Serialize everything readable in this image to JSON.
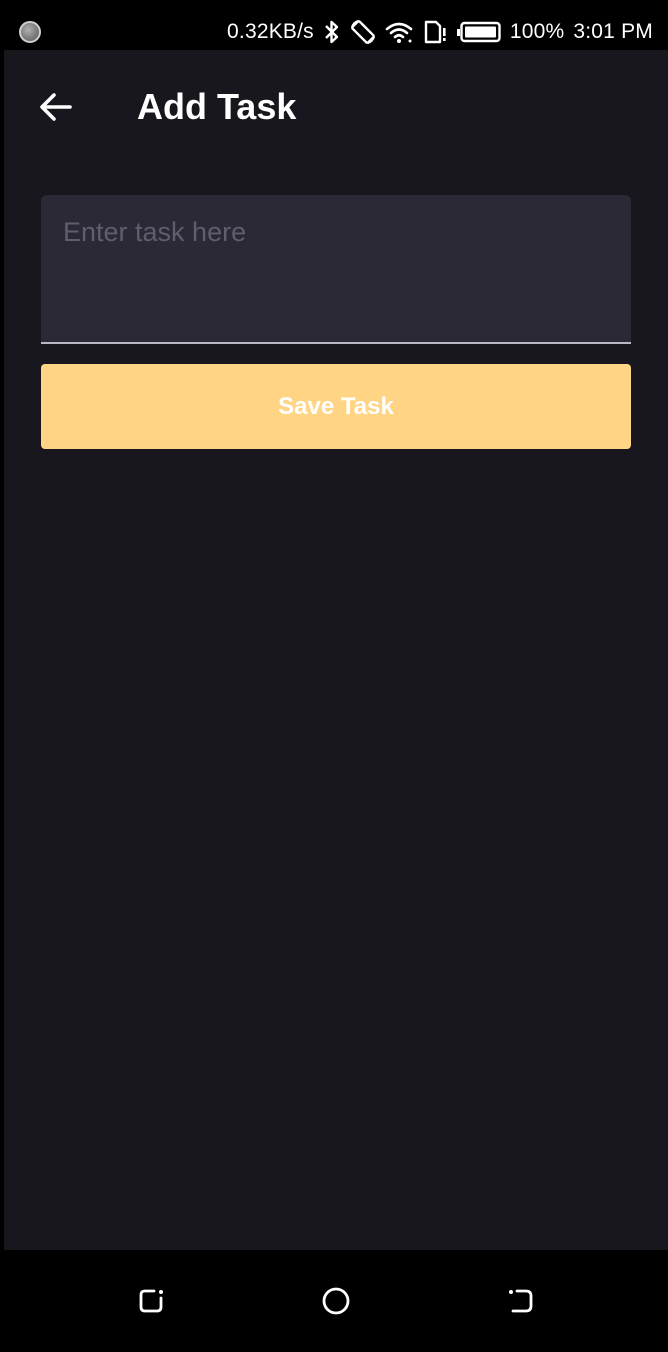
{
  "status_bar": {
    "network_speed": "0.32KB/s",
    "battery": "100%",
    "time": "3:01 PM",
    "icons": [
      "notification-dot-icon",
      "bluetooth-icon",
      "rotation-icon",
      "wifi-icon",
      "sim-icon",
      "battery-icon"
    ]
  },
  "header": {
    "back_icon": "arrow-left-icon",
    "title": "Add Task"
  },
  "form": {
    "task_input": {
      "placeholder": "Enter task here",
      "value": ""
    },
    "save_label": "Save Task"
  },
  "nav_bar": {
    "icons": [
      "recent-apps-icon",
      "home-icon",
      "back-nav-icon"
    ]
  },
  "colors": {
    "background": "#18171e",
    "input_bg": "#2a2935",
    "accent": "#ffd585",
    "placeholder": "#5f5e6d"
  }
}
